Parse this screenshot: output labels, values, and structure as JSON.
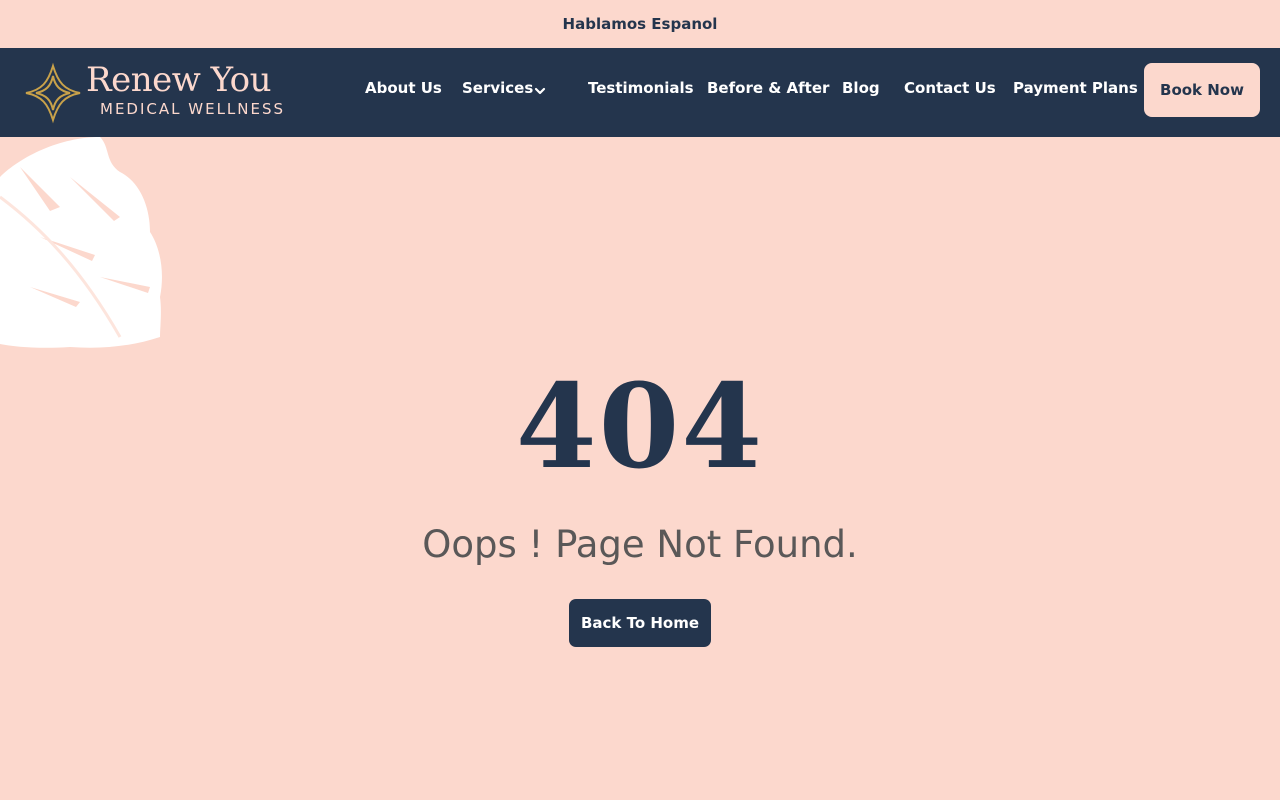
{
  "topbar": {
    "text": "Hablamos Espanol"
  },
  "header": {
    "logo_name": "Renew You",
    "logo_sub": "MEDICAL WELLNESS",
    "nav": {
      "about": "About Us",
      "services": "Services",
      "testimonials": "Testimonials",
      "before_after": "Before & After",
      "blog": "Blog",
      "contact": "Contact Us",
      "payment": "Payment Plans"
    },
    "book_label": "Book Now"
  },
  "main": {
    "error_code": "404",
    "message": "Oops ! Page Not Found.",
    "home_button": "Back To Home"
  },
  "colors": {
    "background": "#fcd8cd",
    "navy": "#24354d",
    "gold": "#c9a24a",
    "message_text": "#5a5858"
  },
  "icons": {
    "logo_mark": "four-point-star-ornament-icon",
    "services_dropdown": "chevron-down-icon",
    "decoration": "monstera-leaf-icon"
  }
}
